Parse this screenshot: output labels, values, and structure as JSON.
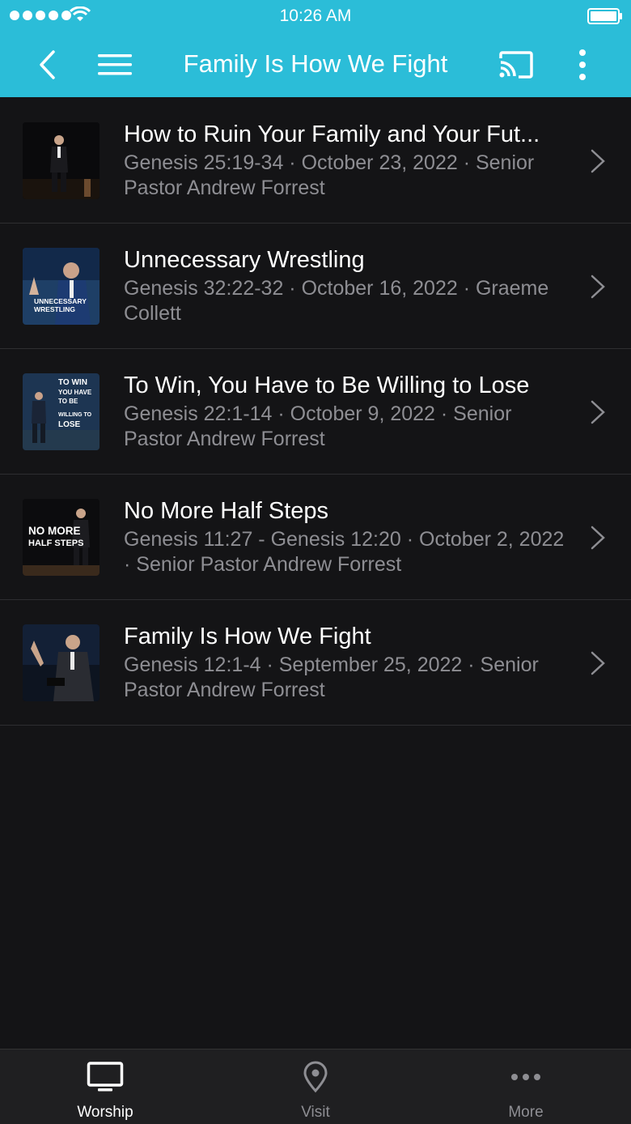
{
  "status_bar": {
    "time": "10:26 AM"
  },
  "nav": {
    "title": "Family Is How We Fight"
  },
  "sermons": [
    {
      "title": "How to Ruin Your Family and Your Fut...",
      "subtitle": "Genesis 25:19-34 · October 23, 2022 · Senior Pastor Andrew Forrest",
      "thumb_text": []
    },
    {
      "title": "Unnecessary Wrestling",
      "subtitle": "Genesis 32:22-32 · October 16, 2022 · Graeme Collett",
      "thumb_text": [
        "UNNECESSARY",
        "WRESTLING"
      ]
    },
    {
      "title": "To Win, You Have to Be Willing to Lose",
      "subtitle": "Genesis 22:1-14 · October 9, 2022 · Senior Pastor Andrew Forrest",
      "thumb_text": [
        "TO WIN",
        "YOU HAVE",
        "TO BE",
        "WILLING TO",
        "LOSE"
      ]
    },
    {
      "title": "No More Half Steps",
      "subtitle": "Genesis 11:27 - Genesis 12:20 · October 2, 2022 · Senior Pastor Andrew Forrest",
      "thumb_text": [
        "NO MORE",
        "HALF STEPS"
      ]
    },
    {
      "title": "Family Is How We Fight",
      "subtitle": "Genesis 12:1-4 · September 25, 2022 · Senior Pastor Andrew Forrest",
      "thumb_text": []
    }
  ],
  "tabs": [
    {
      "label": "Worship",
      "icon": "tv-icon",
      "active": true
    },
    {
      "label": "Visit",
      "icon": "map-pin-icon",
      "active": false
    },
    {
      "label": "More",
      "icon": "ellipsis-icon",
      "active": false
    }
  ],
  "colors": {
    "header": "#2bbdd8",
    "background": "#141416",
    "subtitle": "#8e8e93"
  }
}
